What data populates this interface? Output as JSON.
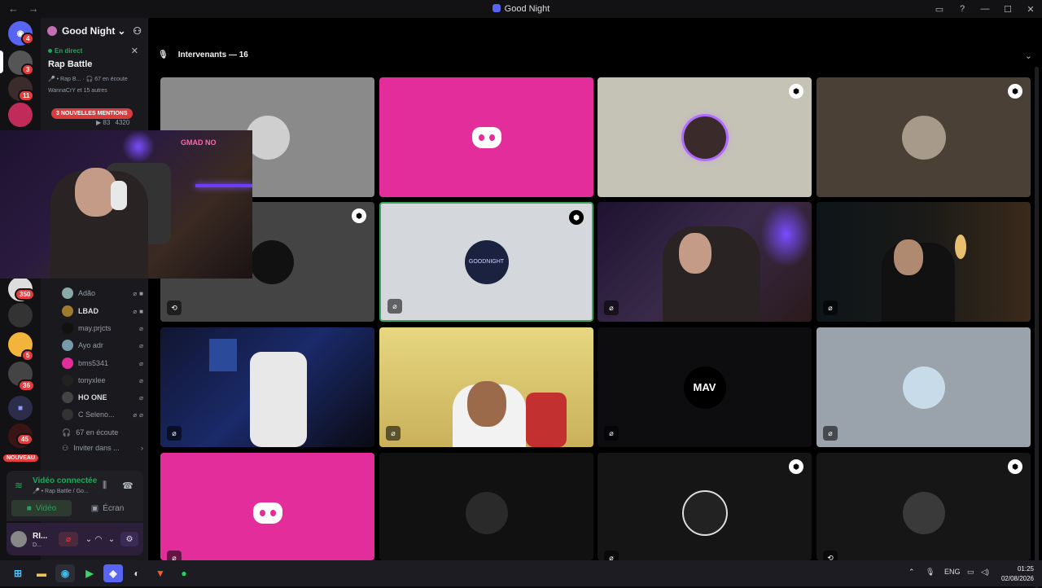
{
  "window": {
    "title": "Good Night",
    "nav": "← →"
  },
  "guild_badges": {
    "dm": "4",
    "g1": "3",
    "g2": "11",
    "g3": "350",
    "g4": "5",
    "g5": "36",
    "g6": "45",
    "new": "NOUVEAU"
  },
  "server": {
    "name": "Good Night"
  },
  "live": {
    "status": "En direct",
    "channel": "Rap Battle",
    "meta": "🎤 • Rap B... · 🎧 67 en écoute",
    "listeners_avatars": "WannaCrY et 15 autres",
    "viewers": "83",
    "count": "4320"
  },
  "mentions": "3 NOUVELLES MENTIONS",
  "voice_members": [
    {
      "name": "Adão"
    },
    {
      "name": "LBAD"
    },
    {
      "name": "may.prjcts"
    },
    {
      "name": "Ayo adr"
    },
    {
      "name": "bms5341"
    },
    {
      "name": "tonyxlee"
    },
    {
      "name": "HO ONE"
    },
    {
      "name": "C Seleno..."
    }
  ],
  "listening": "67 en écoute",
  "invite": "Inviter dans ...",
  "voice_bar": {
    "status": "Vidéo connectée",
    "sub": "🎤 • Rap Battle / Go...",
    "video_label": "Vidéo",
    "screen_label": "Écran"
  },
  "user": {
    "name": "RI...",
    "status": "D..."
  },
  "stage": {
    "header": "Intervenants — 16"
  },
  "colors": {
    "accent": "#5865f2",
    "discord_pink": "#e32d9b",
    "green": "#23a55a"
  },
  "pip": {
    "sign": "GMAD NO"
  },
  "tiles": {
    "mav": "MAV",
    "goodnight": "GOODNIGHT"
  },
  "taskbar": {
    "lang": "ENG",
    "time": "01:25",
    "date": "02/08/2026"
  }
}
